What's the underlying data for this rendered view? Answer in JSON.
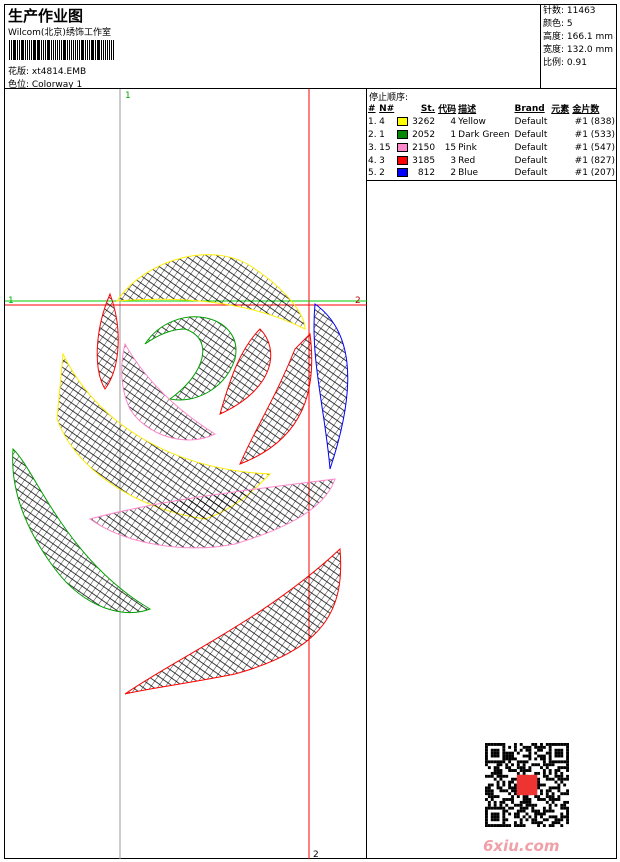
{
  "header": {
    "title": "生产作业图",
    "subtitle": "Wilcom(北京)绣饰工作室",
    "design": "花版: xt4814.EMB",
    "colorway": "色位: Colorway 1"
  },
  "stats": {
    "stitches": "针数: 11463",
    "colors": "颜色: 5",
    "height": "高度: 166.1 mm",
    "width": "宽度: 132.0 mm",
    "scale": "比例: 0.91"
  },
  "panel": {
    "caption": "停止顺序:",
    "headers": [
      "#",
      "N#",
      "St.",
      "代码",
      "描述",
      "Brand",
      "元素",
      "金片数"
    ],
    "rows": [
      {
        "idx": "1.",
        "n": "4",
        "color": "#ffff00",
        "st": "3262",
        "code": "4",
        "desc": "Yellow",
        "brand": "Default",
        "seq": "#1 (838)"
      },
      {
        "idx": "2.",
        "n": "1",
        "color": "#008800",
        "st": "2052",
        "code": "1",
        "desc": "Dark Green",
        "brand": "Default",
        "seq": "#1 (533)"
      },
      {
        "idx": "3.",
        "n": "15",
        "color": "#ff88cc",
        "st": "2150",
        "code": "15",
        "desc": "Pink",
        "brand": "Default",
        "seq": "#1 (547)"
      },
      {
        "idx": "4.",
        "n": "3",
        "color": "#ff0000",
        "st": "3185",
        "code": "3",
        "desc": "Red",
        "brand": "Default",
        "seq": "#1 (827)"
      },
      {
        "idx": "5.",
        "n": "2",
        "color": "#0000ff",
        "st": "812",
        "code": "2",
        "desc": "Blue",
        "brand": "Default",
        "seq": "#1 (207)"
      }
    ]
  },
  "guides": {
    "top": "1",
    "left": "1",
    "right": "2",
    "bottom": "2"
  },
  "watermark": "6xiu.com"
}
